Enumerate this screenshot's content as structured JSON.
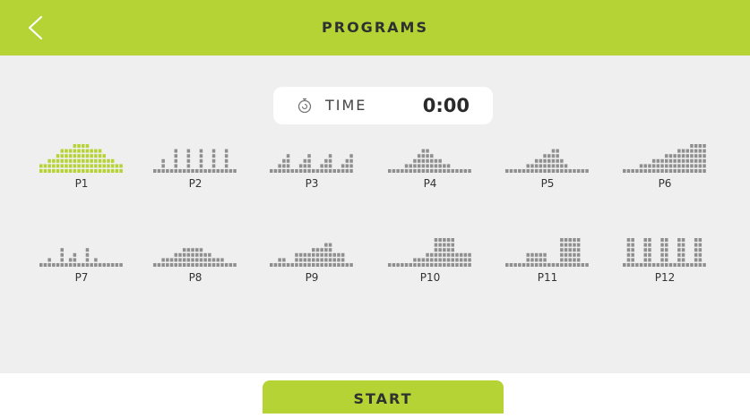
{
  "header": {
    "title": "PROGRAMS",
    "back_icon": "chevron-left-icon"
  },
  "time": {
    "icon": "stopwatch-icon",
    "label": "TIME",
    "value": "0:00"
  },
  "colors": {
    "accent": "#b5d334",
    "selected": "#b5d334",
    "bars": "#8f8f8f",
    "background": "#efefef"
  },
  "programs": [
    {
      "label": "P1",
      "selected": true,
      "profile": [
        2,
        2,
        3,
        3,
        4,
        5,
        5,
        5,
        6,
        6,
        6,
        6,
        5,
        5,
        5,
        4,
        3,
        3,
        2,
        2
      ]
    },
    {
      "label": "P2",
      "selected": false,
      "profile": [
        1,
        1,
        3,
        1,
        1,
        5,
        1,
        1,
        5,
        1,
        1,
        5,
        1,
        1,
        5,
        1,
        1,
        5,
        1,
        1
      ]
    },
    {
      "label": "P3",
      "selected": false,
      "profile": [
        1,
        1,
        2,
        3,
        4,
        1,
        1,
        2,
        3,
        4,
        1,
        1,
        2,
        3,
        4,
        1,
        1,
        2,
        3,
        4
      ]
    },
    {
      "label": "P4",
      "selected": false,
      "profile": [
        1,
        1,
        1,
        1,
        2,
        2,
        3,
        4,
        5,
        5,
        4,
        3,
        3,
        2,
        2,
        1,
        1,
        1,
        1,
        1
      ]
    },
    {
      "label": "P5",
      "selected": false,
      "profile": [
        1,
        1,
        1,
        1,
        1,
        2,
        2,
        3,
        3,
        4,
        4,
        5,
        5,
        3,
        2,
        1,
        1,
        1,
        1,
        1
      ]
    },
    {
      "label": "P6",
      "selected": false,
      "profile": [
        1,
        1,
        1,
        1,
        2,
        2,
        2,
        3,
        3,
        3,
        4,
        4,
        4,
        5,
        5,
        5,
        6,
        6,
        6,
        6
      ]
    },
    {
      "label": "P7",
      "selected": false,
      "profile": [
        1,
        1,
        2,
        1,
        1,
        4,
        1,
        2,
        3,
        1,
        1,
        4,
        1,
        2,
        1,
        1,
        1,
        1,
        1,
        1
      ]
    },
    {
      "label": "P8",
      "selected": false,
      "profile": [
        1,
        1,
        2,
        2,
        2,
        3,
        3,
        4,
        4,
        4,
        4,
        4,
        3,
        3,
        2,
        2,
        2,
        1,
        1,
        1
      ]
    },
    {
      "label": "P9",
      "selected": false,
      "profile": [
        1,
        1,
        2,
        2,
        1,
        1,
        3,
        3,
        3,
        3,
        4,
        4,
        4,
        5,
        5,
        3,
        3,
        3,
        1,
        1
      ]
    },
    {
      "label": "P10",
      "selected": false,
      "profile": [
        1,
        1,
        1,
        1,
        1,
        1,
        2,
        2,
        2,
        3,
        3,
        6,
        6,
        6,
        6,
        6,
        3,
        3,
        3,
        3
      ]
    },
    {
      "label": "P11",
      "selected": false,
      "profile": [
        1,
        1,
        1,
        1,
        1,
        3,
        3,
        3,
        3,
        3,
        1,
        1,
        1,
        6,
        6,
        6,
        6,
        6,
        1,
        1
      ]
    },
    {
      "label": "P12",
      "selected": false,
      "profile": [
        1,
        6,
        6,
        1,
        1,
        6,
        6,
        1,
        1,
        6,
        6,
        1,
        1,
        6,
        6,
        1,
        1,
        6,
        6,
        1
      ]
    }
  ],
  "start_button": {
    "label": "START"
  }
}
